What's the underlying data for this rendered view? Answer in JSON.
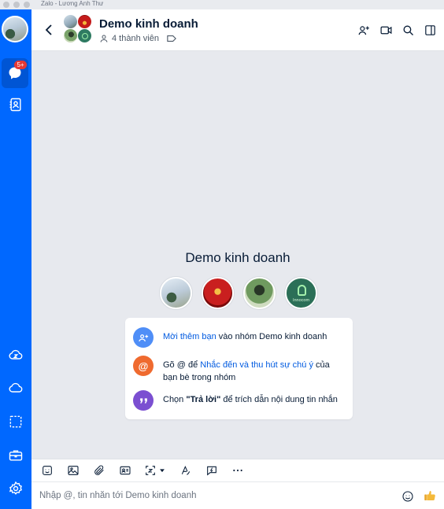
{
  "window": {
    "title": "Zalo - Lương Anh Thư"
  },
  "sidebar": {
    "chat_badge": "5+"
  },
  "header": {
    "title": "Demo kinh doanh",
    "members": "4 thành viên"
  },
  "intro": {
    "title": "Demo kinh doanh",
    "avatar_brand_text": "Innocom"
  },
  "tips": {
    "t1_link": "Mời thêm bạn",
    "t1_rest": " vào nhóm Demo kinh doanh",
    "t2_pre": "Gõ @ để ",
    "t2_link": "Nhắc đến và thu hút sự chú ý",
    "t2_rest": " của bạn bè trong nhóm",
    "t3_pre": "Chọn ",
    "t3_bold": "\"Trả lời\"",
    "t3_rest": " để trích dẫn nội dung tin nhắn"
  },
  "composer": {
    "placeholder": "Nhập @, tin nhắn tới Demo kinh doanh"
  },
  "colors": {
    "brand_blue": "#0068ff",
    "link": "#005ae0",
    "tip_blue": "#4f8ef7",
    "tip_orange": "#ef6a2f",
    "tip_purple": "#7b4fd1"
  },
  "icons": [
    "back-arrow-icon",
    "member-icon",
    "tag-icon",
    "add-member-icon",
    "video-call-icon",
    "search-icon",
    "layout-icon",
    "chat-icon",
    "contacts-icon",
    "cloud-sync-icon",
    "cloud-icon",
    "screenshot-icon",
    "toolbox-icon",
    "settings-icon",
    "sticker-icon",
    "image-icon",
    "attach-icon",
    "contact-card-icon",
    "capture-icon",
    "format-text-icon",
    "quick-message-icon",
    "more-icon",
    "emoji-icon",
    "like-icon"
  ]
}
